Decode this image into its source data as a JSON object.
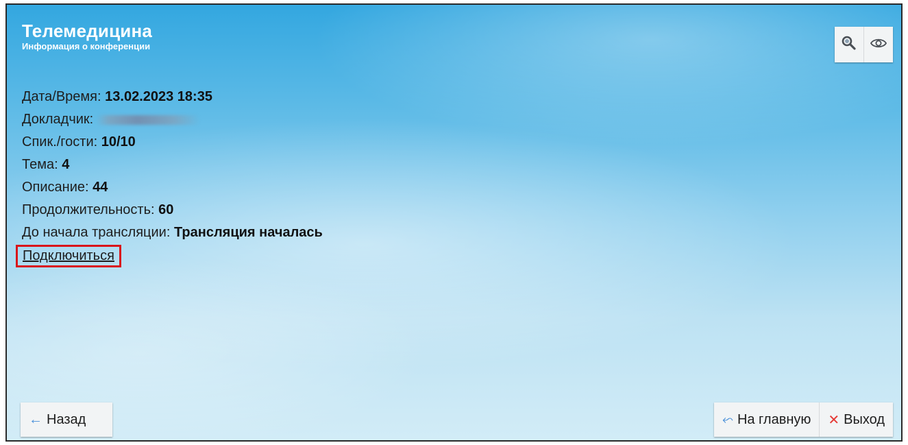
{
  "header": {
    "title": "Телемедицина",
    "subtitle": "Информация о конференции"
  },
  "toolbar": {
    "search_icon": "search-icon",
    "view_icon": "eye-icon"
  },
  "info": {
    "datetime_label": "Дата/Время:",
    "datetime_value": "13.02.2023 18:35",
    "speaker_label": "Докладчик:",
    "speakers_guests_label": "Спик./гости:",
    "speakers_guests_value": "10/10",
    "topic_label": "Тема:",
    "topic_value": "4",
    "description_label": "Описание:",
    "description_value": "44",
    "duration_label": "Продолжительность:",
    "duration_value": "60",
    "until_start_label": "До начала трансляции:",
    "until_start_value": "Трансляция началась",
    "connect_label": "Подключиться"
  },
  "nav": {
    "back_label": "Назад",
    "home_label": "На главную",
    "exit_label": "Выход"
  },
  "colors": {
    "accent_blue": "#4a90d9",
    "exit_red": "#e53935",
    "highlight_red": "#d9141a"
  }
}
